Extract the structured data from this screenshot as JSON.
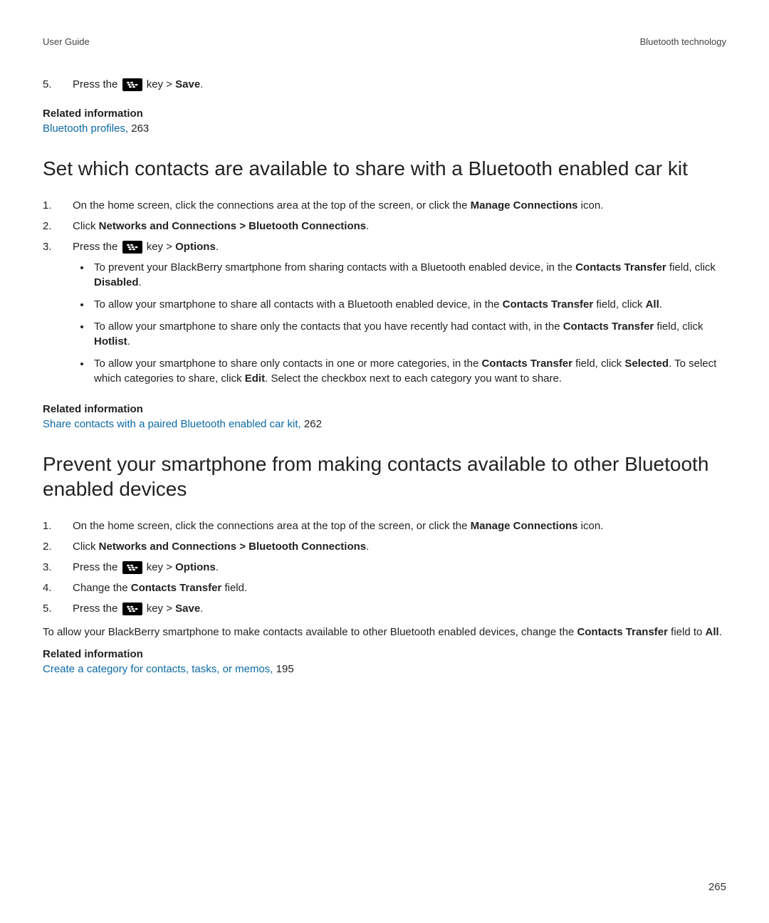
{
  "header": {
    "left": "User Guide",
    "right": "Bluetooth technology"
  },
  "topStep": {
    "num": "5.",
    "press_the": "Press the ",
    "key_gt": " key > ",
    "save": "Save",
    "period": "."
  },
  "related1": {
    "label": "Related information",
    "link_text": "Bluetooth profiles,",
    "page": " 263"
  },
  "section1": {
    "heading": "Set which contacts are available to share with a Bluetooth enabled car kit",
    "step1": {
      "num": "1.",
      "text_a": "On the home screen, click the connections area at the top of the screen, or click the ",
      "bold": "Manage Connections",
      "text_b": " icon."
    },
    "step2": {
      "num": "2.",
      "click": "Click ",
      "nac": "Networks and Connections",
      "gt": " > ",
      "btc": "Bluetooth Connections",
      "period": "."
    },
    "step3": {
      "num": "3.",
      "press_the": "Press the ",
      "key_gt": " key > ",
      "options": "Options",
      "period": "."
    },
    "bullets": {
      "b1": {
        "a": "To prevent your BlackBerry smartphone from sharing contacts with a Bluetooth enabled device, in the ",
        "ct": "Contacts Transfer",
        "b": " field, click ",
        "disabled": "Disabled",
        "c": "."
      },
      "b2": {
        "a": "To allow your smartphone to share all contacts with a Bluetooth enabled device, in the ",
        "ct": "Contacts Transfer",
        "b": " field, click ",
        "all": "All",
        "c": "."
      },
      "b3": {
        "a": "To allow your smartphone to share only the contacts that you have recently had contact with, in the ",
        "ct": "Contacts Transfer",
        "b": " field, click ",
        "hotlist": "Hotlist",
        "c": "."
      },
      "b4": {
        "a": "To allow your smartphone to share only contacts in one or more categories, in the ",
        "ct": "Contacts Transfer",
        "b": " field, click ",
        "selected": "Selected",
        "c": ". To select which categories to share, click ",
        "edit": "Edit",
        "d": ". Select the checkbox next to each category you want to share."
      }
    }
  },
  "related2": {
    "label": "Related information",
    "link_text": "Share contacts with a paired Bluetooth enabled car kit,",
    "page": " 262"
  },
  "section2": {
    "heading": "Prevent your smartphone from making contacts available to other Bluetooth enabled devices",
    "step1": {
      "num": "1.",
      "text_a": "On the home screen, click the connections area at the top of the screen, or click the ",
      "bold": "Manage Connections",
      "text_b": " icon."
    },
    "step2": {
      "num": "2.",
      "click": "Click ",
      "nac": "Networks and Connections",
      "gt": " > ",
      "btc": "Bluetooth Connections",
      "period": "."
    },
    "step3": {
      "num": "3.",
      "press_the": "Press the ",
      "key_gt": " key > ",
      "options": "Options",
      "period": "."
    },
    "step4": {
      "num": "4.",
      "a": "Change the ",
      "ct": "Contacts Transfer",
      "b": " field."
    },
    "step5": {
      "num": "5.",
      "press_the": "Press the ",
      "key_gt": " key > ",
      "save": "Save",
      "period": "."
    },
    "para": {
      "a": "To allow your BlackBerry smartphone to make contacts available to other Bluetooth enabled devices, change the ",
      "ct": "Contacts Transfer",
      "b": " field to ",
      "all": "All",
      "c": "."
    }
  },
  "related3": {
    "label": "Related information",
    "link_text": "Create a category for contacts, tasks, or memos,",
    "page": " 195"
  },
  "page_number": "265"
}
